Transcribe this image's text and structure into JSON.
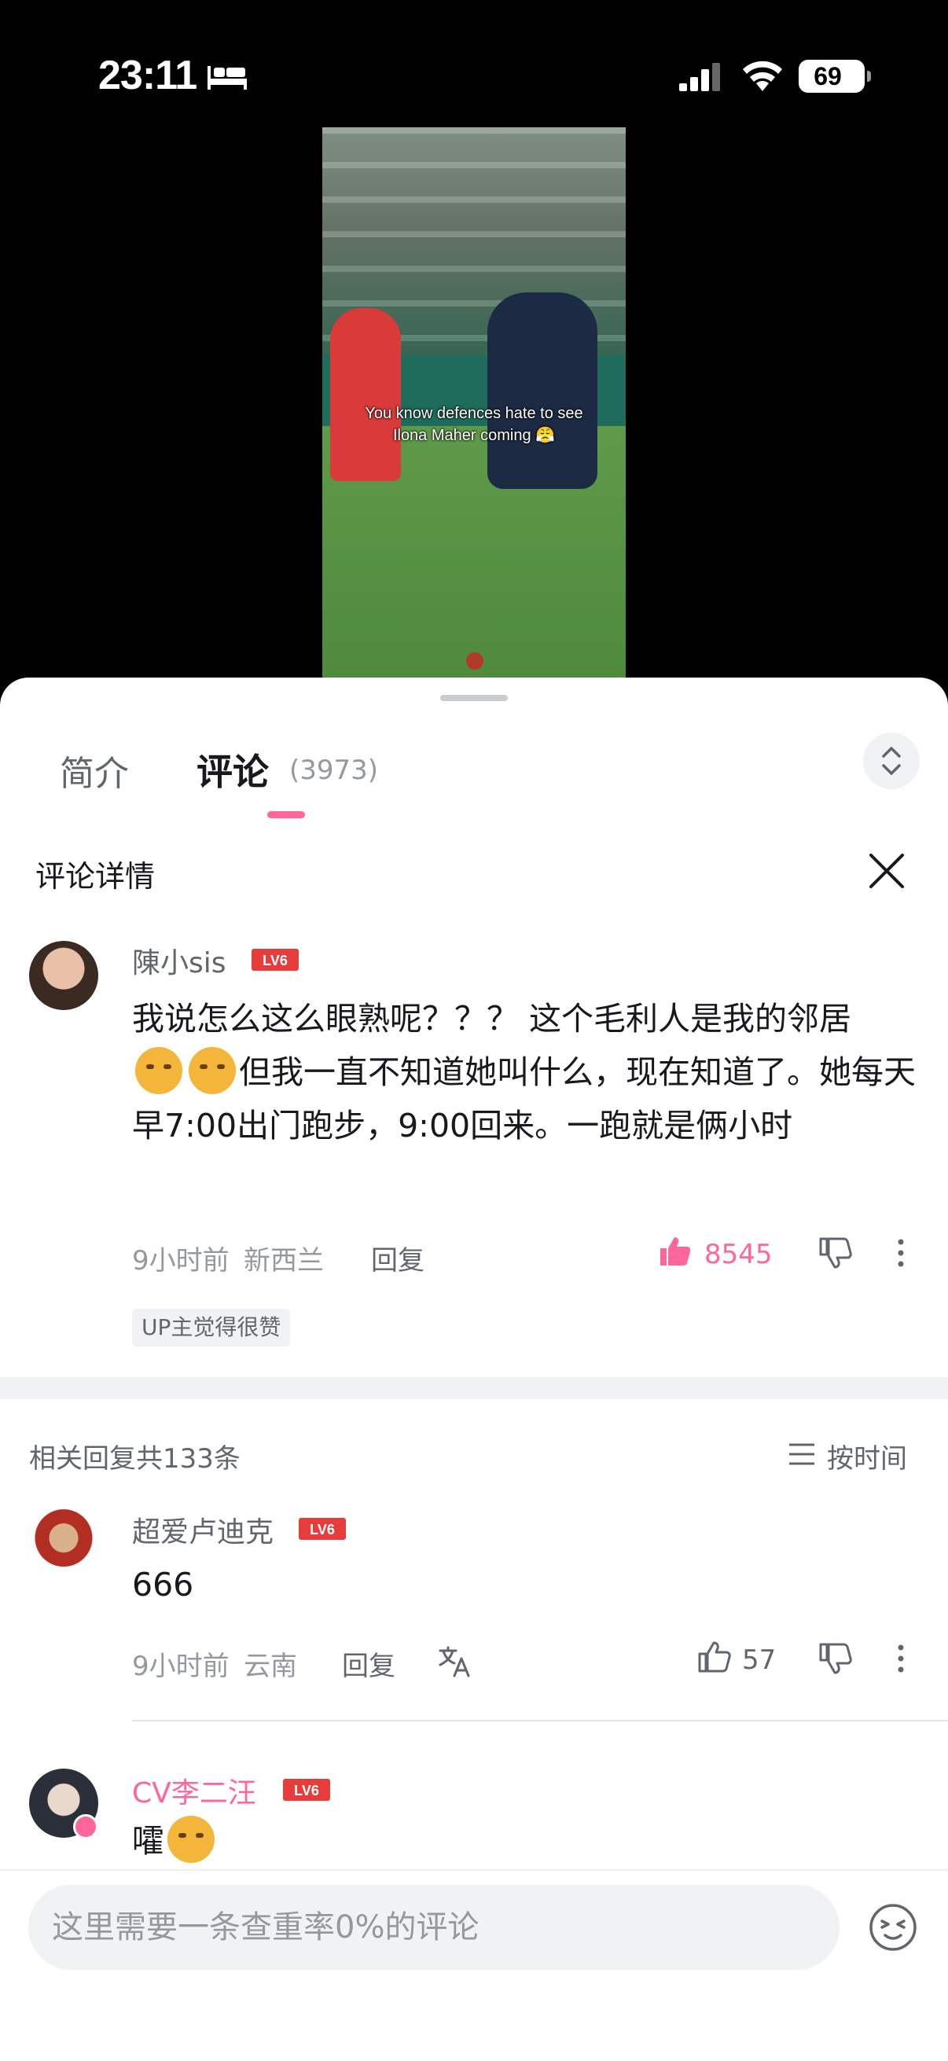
{
  "status_bar": {
    "time": "23:11",
    "battery": "69"
  },
  "video": {
    "caption_line1": "You know defences hate to see",
    "caption_line2": "Ilona Maher coming 😤"
  },
  "tabs": {
    "intro": "简介",
    "comments": "评论",
    "comment_count": "(3973)"
  },
  "detail": {
    "title": "评论详情"
  },
  "main_comment": {
    "username": "陳小sis",
    "level": "LV6",
    "text_part1": "我说怎么这么眼熟呢？？？ 这个毛利人是我的邻居",
    "text_part2": "但我一直不知道她叫什么，现在知道了。她每天早7:00出门跑步，9:00回来。一跑就是俩小时",
    "time": "9小时前",
    "location": "新西兰",
    "reply_label": "回复",
    "likes": "8545",
    "up_badge": "UP主觉得很赞"
  },
  "replies_header": {
    "count": "相关回复共133条",
    "sort": "按时间"
  },
  "replies": [
    {
      "username": "超爱卢迪克",
      "level": "LV6",
      "text": "666",
      "time": "9小时前",
      "location": "云南",
      "reply_label": "回复",
      "likes": "57"
    },
    {
      "username": "CV李二汪",
      "level": "LV6",
      "text": "嚯"
    }
  ],
  "input": {
    "placeholder": "这里需要一条查重率0%的评论"
  },
  "colors": {
    "accent_pink": "#ff6699",
    "level_red": "#e63c3c"
  },
  "icons": [
    "bed-icon",
    "signal-icon",
    "wifi-icon",
    "expand-icon",
    "close-icon",
    "like-icon",
    "dislike-icon",
    "more-icon",
    "translate-icon",
    "sort-icon",
    "emoji-icon"
  ]
}
